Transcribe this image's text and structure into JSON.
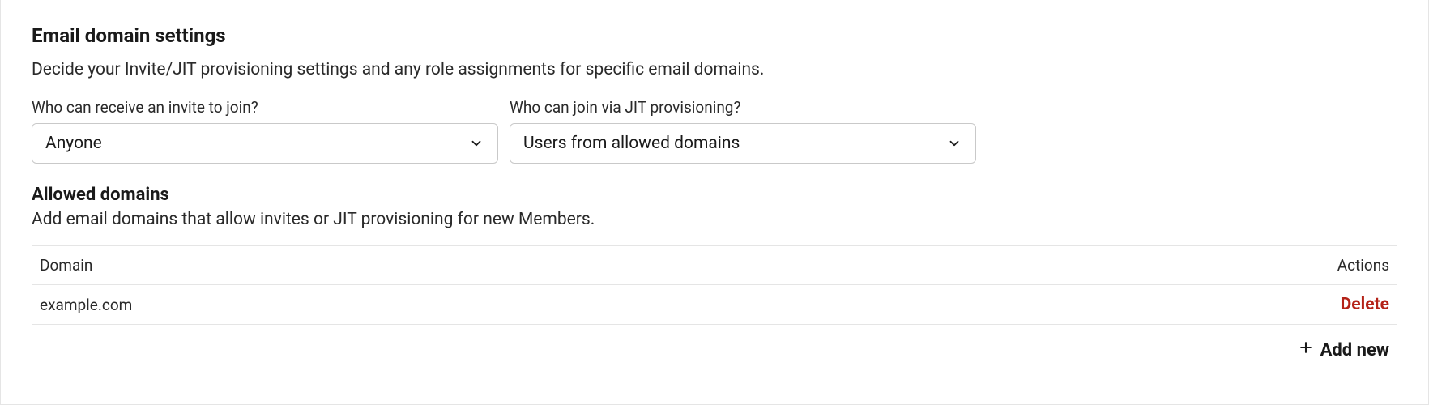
{
  "section": {
    "title": "Email domain settings",
    "description": "Decide your Invite/JIT provisioning settings and any role assignments for specific email domains."
  },
  "dropdowns": {
    "invite": {
      "label": "Who can receive an invite to join?",
      "value": "Anyone"
    },
    "jit": {
      "label": "Who can join via JIT provisioning?",
      "value": "Users from allowed domains"
    }
  },
  "allowed": {
    "title": "Allowed domains",
    "description": "Add email domains that allow invites or JIT provisioning for new Members."
  },
  "table": {
    "headers": {
      "domain": "Domain",
      "actions": "Actions"
    },
    "rows": [
      {
        "domain": "example.com",
        "action": "Delete"
      }
    ]
  },
  "addNew": {
    "label": "Add new"
  }
}
